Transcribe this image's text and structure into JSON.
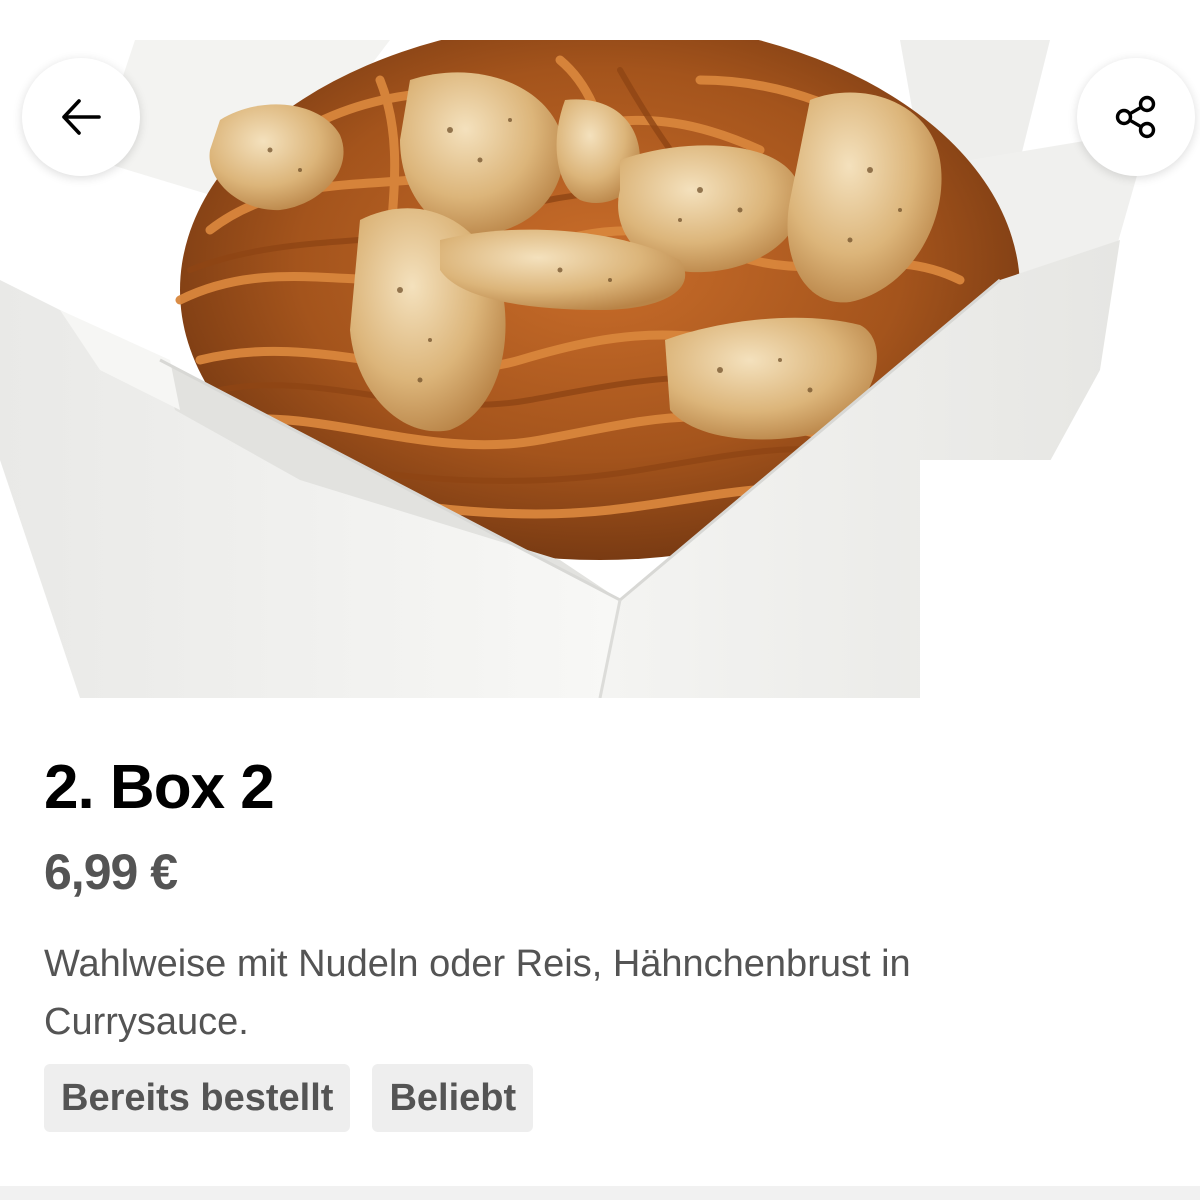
{
  "product": {
    "title": "2. Box 2",
    "price": "6,99 €",
    "description": "Wahlweise mit Nudeln oder Reis, Hähnchenbrust in Currysauce.",
    "tags": [
      "Bereits bestellt",
      "Beliebt"
    ]
  },
  "toolbar": {
    "back_icon": "arrow-left-icon",
    "share_icon": "share-icon"
  },
  "colors": {
    "title": "#000000",
    "secondary_text": "#545454",
    "tag_background": "#eeeeee"
  }
}
